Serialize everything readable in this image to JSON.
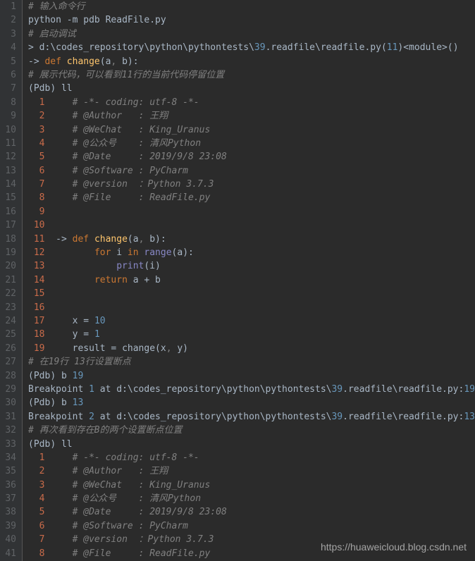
{
  "watermark": "https://huaweicloud.blog.csdn.net",
  "lines": [
    {
      "n": "1",
      "seg": [
        {
          "t": "# 输入命令行",
          "c": "c-comment"
        }
      ]
    },
    {
      "n": "2",
      "seg": [
        {
          "t": "python ",
          "c": "c-default"
        },
        {
          "t": "-",
          "c": "c-default"
        },
        {
          "t": "m pdb ReadFile",
          "c": "c-default"
        },
        {
          "t": ".",
          "c": "c-default"
        },
        {
          "t": "py",
          "c": "c-default"
        }
      ]
    },
    {
      "n": "3",
      "seg": [
        {
          "t": "# 启动调试",
          "c": "c-comment"
        }
      ]
    },
    {
      "n": "4",
      "seg": [
        {
          "t": "> ",
          "c": "c-default"
        },
        {
          "t": "d",
          "c": "c-default"
        },
        {
          "t": ":",
          "c": "c-default"
        },
        {
          "t": "\\codes_repository\\python\\pythontests\\",
          "c": "c-default"
        },
        {
          "t": "39",
          "c": "c-num"
        },
        {
          "t": ".",
          "c": "c-default"
        },
        {
          "t": "readfile\\readfile",
          "c": "c-default"
        },
        {
          "t": ".",
          "c": "c-default"
        },
        {
          "t": "py",
          "c": "c-default"
        },
        {
          "t": "(",
          "c": "c-default"
        },
        {
          "t": "11",
          "c": "c-num"
        },
        {
          "t": ")<",
          "c": "c-default"
        },
        {
          "t": "module",
          "c": "c-default"
        },
        {
          "t": ">()",
          "c": "c-default"
        }
      ]
    },
    {
      "n": "5",
      "seg": [
        {
          "t": "-> ",
          "c": "c-default"
        },
        {
          "t": "def ",
          "c": "c-keyword"
        },
        {
          "t": "change",
          "c": "c-func"
        },
        {
          "t": "(",
          "c": "c-default"
        },
        {
          "t": "a",
          "c": "c-default"
        },
        {
          "t": ", ",
          "c": "c-gray"
        },
        {
          "t": "b",
          "c": "c-default"
        },
        {
          "t": "):",
          "c": "c-default"
        }
      ]
    },
    {
      "n": "6",
      "seg": [
        {
          "t": "# 展示代码，可以看到11行的当前代码停留位置",
          "c": "c-comment"
        }
      ]
    },
    {
      "n": "7",
      "seg": [
        {
          "t": "(",
          "c": "c-default"
        },
        {
          "t": "Pdb",
          "c": "c-default"
        },
        {
          "t": ") ",
          "c": "c-default"
        },
        {
          "t": "ll",
          "c": "c-default"
        }
      ]
    },
    {
      "n": "8",
      "seg": [
        {
          "t": "  ",
          "c": "c-default"
        },
        {
          "t": "1",
          "c": "c-subnum"
        },
        {
          "t": "     ",
          "c": "c-default"
        },
        {
          "t": "# -*- coding: utf-8 -*-",
          "c": "c-comment"
        }
      ]
    },
    {
      "n": "9",
      "seg": [
        {
          "t": "  ",
          "c": "c-default"
        },
        {
          "t": "2",
          "c": "c-subnum"
        },
        {
          "t": "     ",
          "c": "c-default"
        },
        {
          "t": "# @Author   : 王翔",
          "c": "c-comment"
        }
      ]
    },
    {
      "n": "10",
      "seg": [
        {
          "t": "  ",
          "c": "c-default"
        },
        {
          "t": "3",
          "c": "c-subnum"
        },
        {
          "t": "     ",
          "c": "c-default"
        },
        {
          "t": "# @WeChat   : King_Uranus",
          "c": "c-comment"
        }
      ]
    },
    {
      "n": "11",
      "seg": [
        {
          "t": "  ",
          "c": "c-default"
        },
        {
          "t": "4",
          "c": "c-subnum"
        },
        {
          "t": "     ",
          "c": "c-default"
        },
        {
          "t": "# @公众号    : 清风Python",
          "c": "c-comment"
        }
      ]
    },
    {
      "n": "12",
      "seg": [
        {
          "t": "  ",
          "c": "c-default"
        },
        {
          "t": "5",
          "c": "c-subnum"
        },
        {
          "t": "     ",
          "c": "c-default"
        },
        {
          "t": "# @Date     : 2019/9/8 23:08",
          "c": "c-comment"
        }
      ]
    },
    {
      "n": "13",
      "seg": [
        {
          "t": "  ",
          "c": "c-default"
        },
        {
          "t": "6",
          "c": "c-subnum"
        },
        {
          "t": "     ",
          "c": "c-default"
        },
        {
          "t": "# @Software : PyCharm",
          "c": "c-comment"
        }
      ]
    },
    {
      "n": "14",
      "seg": [
        {
          "t": "  ",
          "c": "c-default"
        },
        {
          "t": "7",
          "c": "c-subnum"
        },
        {
          "t": "     ",
          "c": "c-default"
        },
        {
          "t": "# @version  ：Python 3.7.3",
          "c": "c-comment"
        }
      ]
    },
    {
      "n": "15",
      "seg": [
        {
          "t": "  ",
          "c": "c-default"
        },
        {
          "t": "8",
          "c": "c-subnum"
        },
        {
          "t": "     ",
          "c": "c-default"
        },
        {
          "t": "# @File     : ReadFile.py",
          "c": "c-comment"
        }
      ]
    },
    {
      "n": "16",
      "seg": [
        {
          "t": "  ",
          "c": "c-default"
        },
        {
          "t": "9",
          "c": "c-subnum"
        }
      ]
    },
    {
      "n": "17",
      "seg": [
        {
          "t": " ",
          "c": "c-default"
        },
        {
          "t": "10",
          "c": "c-subnum"
        }
      ]
    },
    {
      "n": "18",
      "seg": [
        {
          "t": " ",
          "c": "c-default"
        },
        {
          "t": "11",
          "c": "c-subnum"
        },
        {
          "t": "  -> ",
          "c": "c-default"
        },
        {
          "t": "def ",
          "c": "c-keyword"
        },
        {
          "t": "change",
          "c": "c-func"
        },
        {
          "t": "(",
          "c": "c-default"
        },
        {
          "t": "a",
          "c": "c-default"
        },
        {
          "t": ", ",
          "c": "c-gray"
        },
        {
          "t": "b",
          "c": "c-default"
        },
        {
          "t": "):",
          "c": "c-default"
        }
      ]
    },
    {
      "n": "19",
      "seg": [
        {
          "t": " ",
          "c": "c-default"
        },
        {
          "t": "12",
          "c": "c-subnum"
        },
        {
          "t": "         ",
          "c": "c-default"
        },
        {
          "t": "for ",
          "c": "c-keyword"
        },
        {
          "t": "i ",
          "c": "c-default"
        },
        {
          "t": "in ",
          "c": "c-keyword"
        },
        {
          "t": "range",
          "c": "c-builtin"
        },
        {
          "t": "(",
          "c": "c-default"
        },
        {
          "t": "a",
          "c": "c-default"
        },
        {
          "t": "):",
          "c": "c-default"
        }
      ]
    },
    {
      "n": "20",
      "seg": [
        {
          "t": " ",
          "c": "c-default"
        },
        {
          "t": "13",
          "c": "c-subnum"
        },
        {
          "t": "             ",
          "c": "c-default"
        },
        {
          "t": "print",
          "c": "c-builtin"
        },
        {
          "t": "(",
          "c": "c-default"
        },
        {
          "t": "i",
          "c": "c-default"
        },
        {
          "t": ")",
          "c": "c-default"
        }
      ]
    },
    {
      "n": "21",
      "seg": [
        {
          "t": " ",
          "c": "c-default"
        },
        {
          "t": "14",
          "c": "c-subnum"
        },
        {
          "t": "         ",
          "c": "c-default"
        },
        {
          "t": "return ",
          "c": "c-keyword"
        },
        {
          "t": "a ",
          "c": "c-default"
        },
        {
          "t": "+ ",
          "c": "c-default"
        },
        {
          "t": "b",
          "c": "c-default"
        }
      ]
    },
    {
      "n": "22",
      "seg": [
        {
          "t": " ",
          "c": "c-default"
        },
        {
          "t": "15",
          "c": "c-subnum"
        }
      ]
    },
    {
      "n": "23",
      "seg": [
        {
          "t": " ",
          "c": "c-default"
        },
        {
          "t": "16",
          "c": "c-subnum"
        }
      ]
    },
    {
      "n": "24",
      "seg": [
        {
          "t": " ",
          "c": "c-default"
        },
        {
          "t": "17",
          "c": "c-subnum"
        },
        {
          "t": "     x ",
          "c": "c-default"
        },
        {
          "t": "= ",
          "c": "c-default"
        },
        {
          "t": "10",
          "c": "c-num"
        }
      ]
    },
    {
      "n": "25",
      "seg": [
        {
          "t": " ",
          "c": "c-default"
        },
        {
          "t": "18",
          "c": "c-subnum"
        },
        {
          "t": "     y ",
          "c": "c-default"
        },
        {
          "t": "= ",
          "c": "c-default"
        },
        {
          "t": "1",
          "c": "c-num"
        }
      ]
    },
    {
      "n": "26",
      "seg": [
        {
          "t": " ",
          "c": "c-default"
        },
        {
          "t": "19",
          "c": "c-subnum"
        },
        {
          "t": "     result ",
          "c": "c-default"
        },
        {
          "t": "= ",
          "c": "c-default"
        },
        {
          "t": "change",
          "c": "c-default"
        },
        {
          "t": "(",
          "c": "c-default"
        },
        {
          "t": "x",
          "c": "c-default"
        },
        {
          "t": ", ",
          "c": "c-gray"
        },
        {
          "t": "y",
          "c": "c-default"
        },
        {
          "t": ")",
          "c": "c-default"
        }
      ]
    },
    {
      "n": "27",
      "seg": [
        {
          "t": "# 在19行 13行设置断点",
          "c": "c-comment"
        }
      ]
    },
    {
      "n": "28",
      "seg": [
        {
          "t": "(",
          "c": "c-default"
        },
        {
          "t": "Pdb",
          "c": "c-default"
        },
        {
          "t": ") b ",
          "c": "c-default"
        },
        {
          "t": "19",
          "c": "c-num"
        }
      ]
    },
    {
      "n": "29",
      "seg": [
        {
          "t": "Breakpoint ",
          "c": "c-default"
        },
        {
          "t": "1",
          "c": "c-num"
        },
        {
          "t": " at d",
          "c": "c-default"
        },
        {
          "t": ":",
          "c": "c-default"
        },
        {
          "t": "\\codes_repository\\python\\pythontests\\",
          "c": "c-default"
        },
        {
          "t": "39",
          "c": "c-num"
        },
        {
          "t": ".",
          "c": "c-default"
        },
        {
          "t": "readfile\\readfile",
          "c": "c-default"
        },
        {
          "t": ".",
          "c": "c-default"
        },
        {
          "t": "py",
          "c": "c-default"
        },
        {
          "t": ":",
          "c": "c-default"
        },
        {
          "t": "19",
          "c": "c-num"
        }
      ]
    },
    {
      "n": "30",
      "seg": [
        {
          "t": "(",
          "c": "c-default"
        },
        {
          "t": "Pdb",
          "c": "c-default"
        },
        {
          "t": ") b ",
          "c": "c-default"
        },
        {
          "t": "13",
          "c": "c-num"
        }
      ]
    },
    {
      "n": "31",
      "seg": [
        {
          "t": "Breakpoint ",
          "c": "c-default"
        },
        {
          "t": "2",
          "c": "c-num"
        },
        {
          "t": " at d",
          "c": "c-default"
        },
        {
          "t": ":",
          "c": "c-default"
        },
        {
          "t": "\\codes_repository\\python\\pythontests\\",
          "c": "c-default"
        },
        {
          "t": "39",
          "c": "c-num"
        },
        {
          "t": ".",
          "c": "c-default"
        },
        {
          "t": "readfile\\readfile",
          "c": "c-default"
        },
        {
          "t": ".",
          "c": "c-default"
        },
        {
          "t": "py",
          "c": "c-default"
        },
        {
          "t": ":",
          "c": "c-default"
        },
        {
          "t": "13",
          "c": "c-num"
        }
      ]
    },
    {
      "n": "32",
      "seg": [
        {
          "t": "# 再次看到存在B的两个设置断点位置",
          "c": "c-comment"
        }
      ]
    },
    {
      "n": "33",
      "seg": [
        {
          "t": "(",
          "c": "c-default"
        },
        {
          "t": "Pdb",
          "c": "c-default"
        },
        {
          "t": ") ll",
          "c": "c-default"
        }
      ]
    },
    {
      "n": "34",
      "seg": [
        {
          "t": "  ",
          "c": "c-default"
        },
        {
          "t": "1",
          "c": "c-subnum"
        },
        {
          "t": "     ",
          "c": "c-default"
        },
        {
          "t": "# -*- coding: utf-8 -*-",
          "c": "c-comment"
        }
      ]
    },
    {
      "n": "35",
      "seg": [
        {
          "t": "  ",
          "c": "c-default"
        },
        {
          "t": "2",
          "c": "c-subnum"
        },
        {
          "t": "     ",
          "c": "c-default"
        },
        {
          "t": "# @Author   : 王翔",
          "c": "c-comment"
        }
      ]
    },
    {
      "n": "36",
      "seg": [
        {
          "t": "  ",
          "c": "c-default"
        },
        {
          "t": "3",
          "c": "c-subnum"
        },
        {
          "t": "     ",
          "c": "c-default"
        },
        {
          "t": "# @WeChat   : King_Uranus",
          "c": "c-comment"
        }
      ]
    },
    {
      "n": "37",
      "seg": [
        {
          "t": "  ",
          "c": "c-default"
        },
        {
          "t": "4",
          "c": "c-subnum"
        },
        {
          "t": "     ",
          "c": "c-default"
        },
        {
          "t": "# @公众号    : 清风Python",
          "c": "c-comment"
        }
      ]
    },
    {
      "n": "38",
      "seg": [
        {
          "t": "  ",
          "c": "c-default"
        },
        {
          "t": "5",
          "c": "c-subnum"
        },
        {
          "t": "     ",
          "c": "c-default"
        },
        {
          "t": "# @Date     : 2019/9/8 23:08",
          "c": "c-comment"
        }
      ]
    },
    {
      "n": "39",
      "seg": [
        {
          "t": "  ",
          "c": "c-default"
        },
        {
          "t": "6",
          "c": "c-subnum"
        },
        {
          "t": "     ",
          "c": "c-default"
        },
        {
          "t": "# @Software : PyCharm",
          "c": "c-comment"
        }
      ]
    },
    {
      "n": "40",
      "seg": [
        {
          "t": "  ",
          "c": "c-default"
        },
        {
          "t": "7",
          "c": "c-subnum"
        },
        {
          "t": "     ",
          "c": "c-default"
        },
        {
          "t": "# @version  ：Python 3.7.3",
          "c": "c-comment"
        }
      ]
    },
    {
      "n": "41",
      "seg": [
        {
          "t": "  ",
          "c": "c-default"
        },
        {
          "t": "8",
          "c": "c-subnum"
        },
        {
          "t": "     ",
          "c": "c-default"
        },
        {
          "t": "# @File     : ReadFile.py",
          "c": "c-comment"
        }
      ]
    }
  ]
}
